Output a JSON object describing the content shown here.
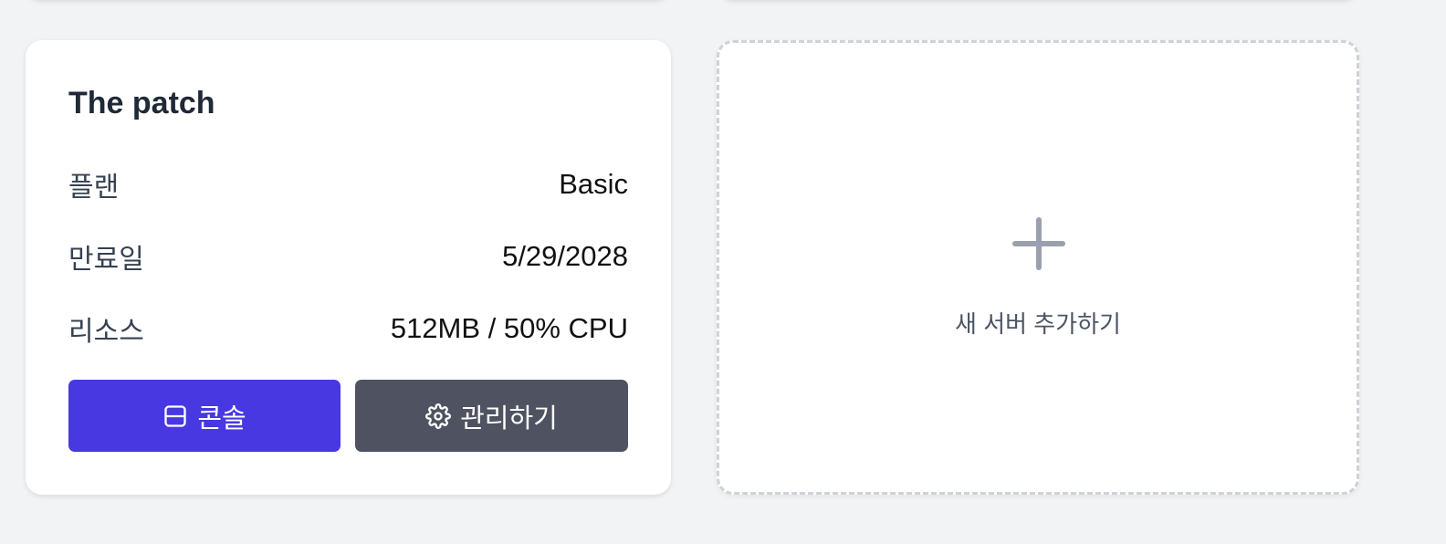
{
  "server_card": {
    "title": "The patch",
    "rows": [
      {
        "label": "플랜",
        "value": "Basic"
      },
      {
        "label": "만료일",
        "value": "5/29/2028"
      },
      {
        "label": "리소스",
        "value": "512MB / 50% CPU"
      }
    ],
    "buttons": {
      "console_label": "콘솔",
      "console_icon": "console-icon",
      "manage_label": "관리하기",
      "manage_icon": "gear-icon"
    }
  },
  "add_card": {
    "label": "새 서버 추가하기",
    "icon": "plus-icon"
  },
  "colors": {
    "primary": "#4838e2",
    "secondary": "#4f5361",
    "background": "#f2f3f5"
  }
}
